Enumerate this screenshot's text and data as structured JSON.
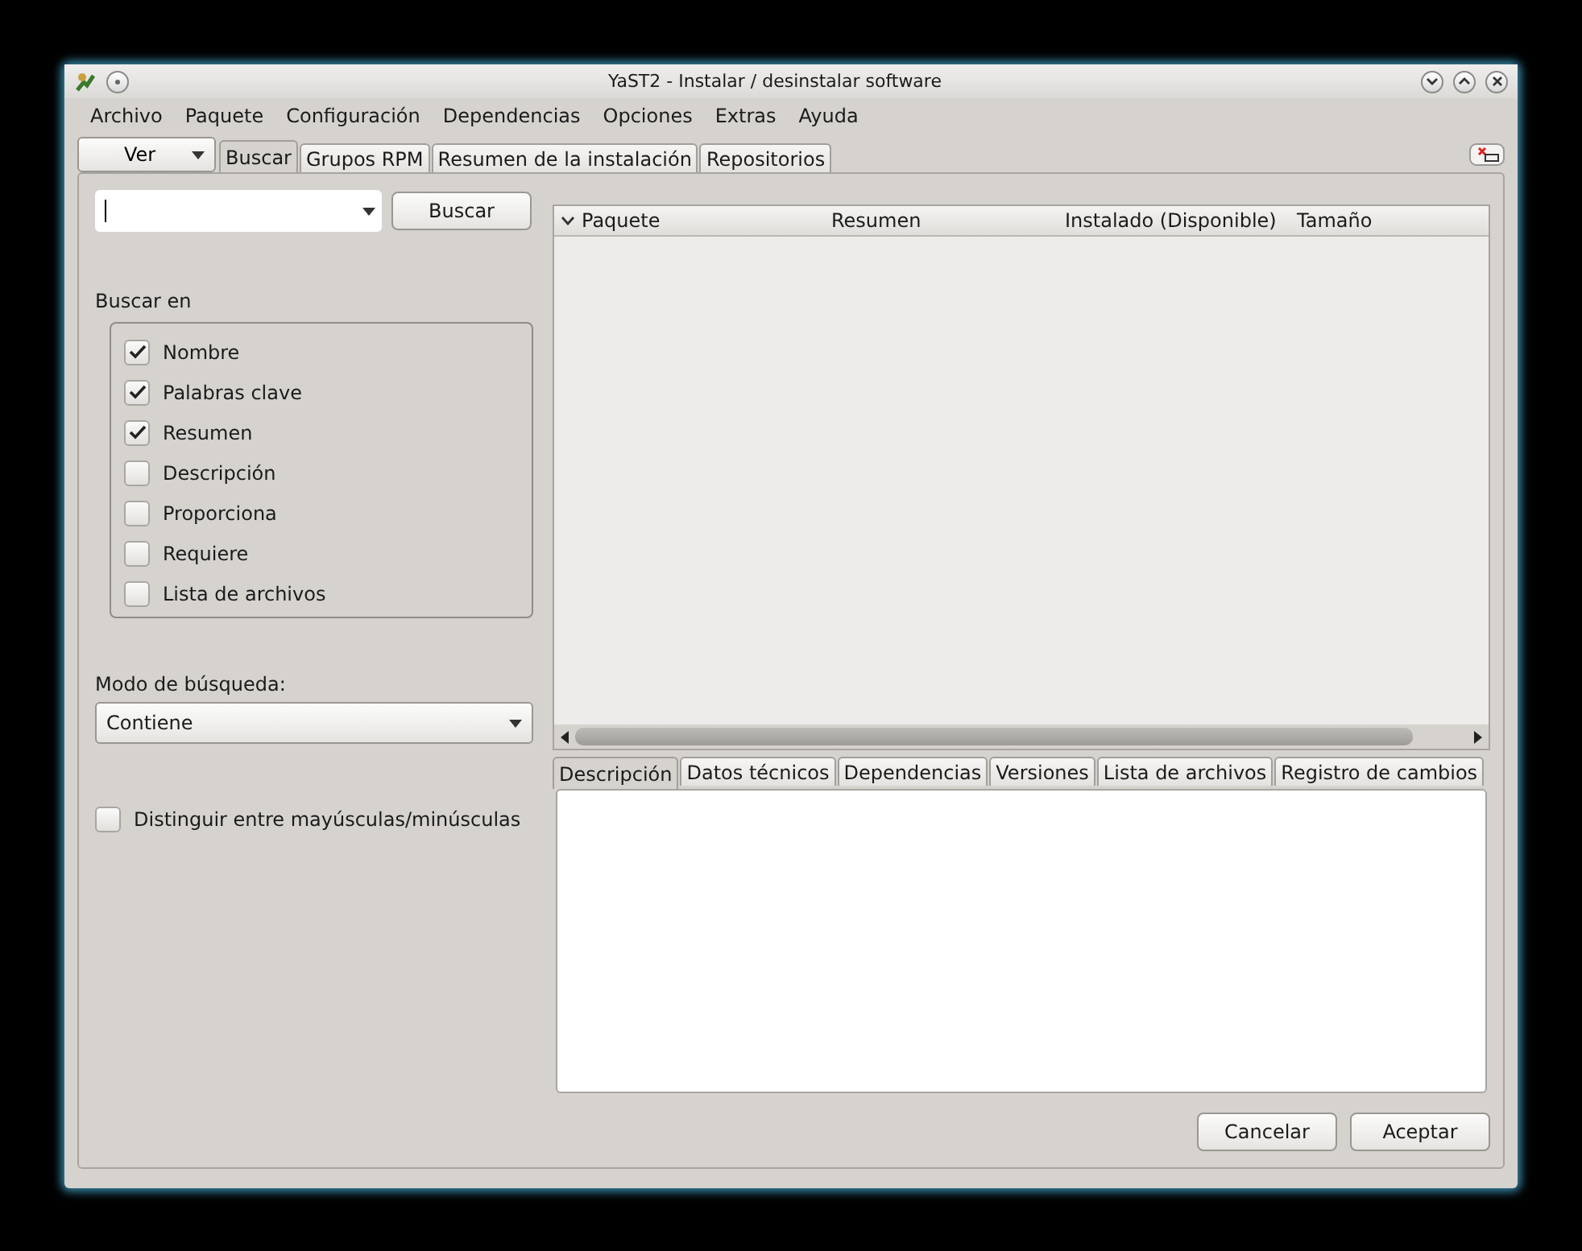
{
  "window": {
    "title": "YaST2 - Instalar / desinstalar software"
  },
  "menu": [
    "Archivo",
    "Paquete",
    "Configuración",
    "Dependencias",
    "Opciones",
    "Extras",
    "Ayuda"
  ],
  "view_button": {
    "label": "Ver"
  },
  "tabs": [
    {
      "label": "Buscar",
      "selected": true
    },
    {
      "label": "Grupos RPM",
      "selected": false
    },
    {
      "label": "Resumen de la instalación",
      "selected": false
    },
    {
      "label": "Repositorios",
      "selected": false
    }
  ],
  "search": {
    "button": "Buscar"
  },
  "search_in": {
    "label": "Buscar en",
    "options": [
      {
        "label": "Nombre",
        "checked": true
      },
      {
        "label": "Palabras clave",
        "checked": true
      },
      {
        "label": "Resumen",
        "checked": true
      },
      {
        "label": "Descripción",
        "checked": false
      },
      {
        "label": "Proporciona",
        "checked": false
      },
      {
        "label": "Requiere",
        "checked": false
      },
      {
        "label": "Lista de archivos",
        "checked": false
      }
    ]
  },
  "search_mode": {
    "label": "Modo de búsqueda:",
    "value": "Contiene"
  },
  "case_sensitive": {
    "label": "Distinguir entre mayúsculas/minúsculas",
    "checked": false
  },
  "table": {
    "columns": [
      "Paquete",
      "Resumen",
      "Instalado (Disponible)",
      "Tamaño"
    ]
  },
  "detail_tabs": [
    {
      "label": "Descripción",
      "selected": true
    },
    {
      "label": "Datos técnicos",
      "selected": false
    },
    {
      "label": "Dependencias",
      "selected": false
    },
    {
      "label": "Versiones",
      "selected": false
    },
    {
      "label": "Lista de archivos",
      "selected": false
    },
    {
      "label": "Registro de cambios",
      "selected": false
    }
  ],
  "buttons": [
    "Cancelar",
    "Aceptar"
  ]
}
